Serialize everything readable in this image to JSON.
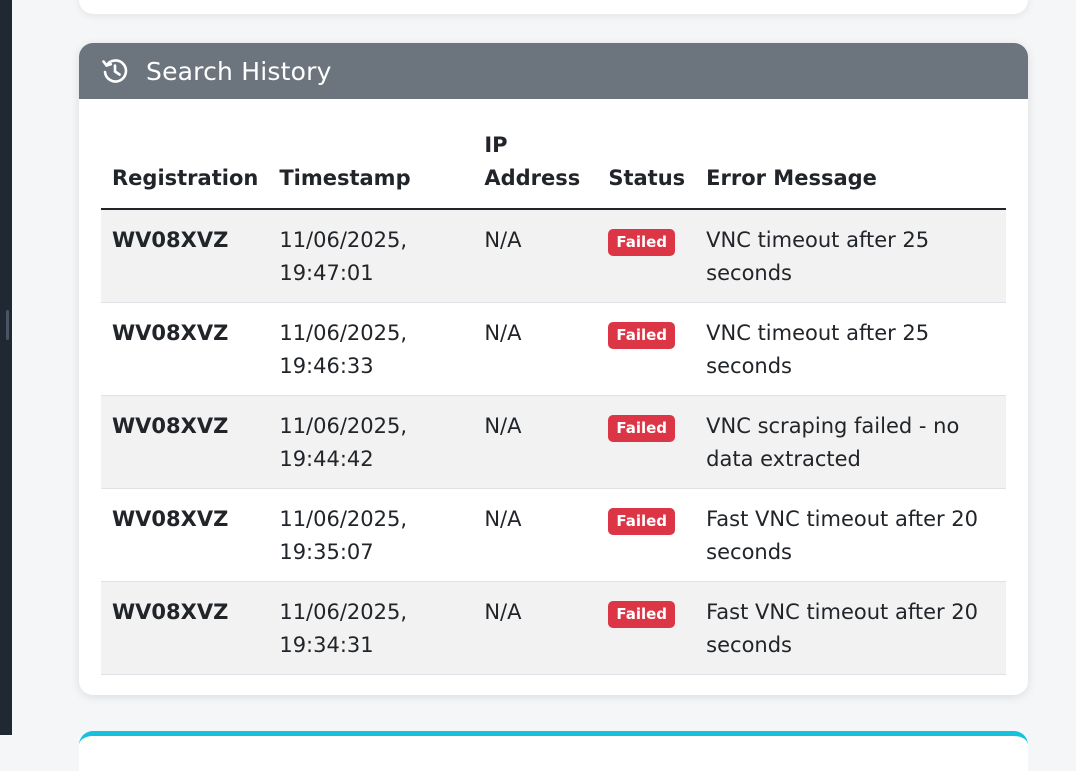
{
  "card": {
    "title": "Search History",
    "icon": "history-icon"
  },
  "table": {
    "headers": {
      "registration": "Registration",
      "timestamp": "Timestamp",
      "ip_line1": "IP",
      "ip_line2": "Address",
      "status": "Status",
      "error": "Error Message"
    },
    "rows": [
      {
        "registration": "WV08XVZ",
        "timestamp": "11/06/2025, 19:47:01",
        "ip": "N/A",
        "status": "Failed",
        "error": "VNC timeout after 25 seconds"
      },
      {
        "registration": "WV08XVZ",
        "timestamp": "11/06/2025, 19:46:33",
        "ip": "N/A",
        "status": "Failed",
        "error": "VNC timeout after 25 seconds"
      },
      {
        "registration": "WV08XVZ",
        "timestamp": "11/06/2025, 19:44:42",
        "ip": "N/A",
        "status": "Failed",
        "error": "VNC scraping failed - no data extracted"
      },
      {
        "registration": "WV08XVZ",
        "timestamp": "11/06/2025, 19:35:07",
        "ip": "N/A",
        "status": "Failed",
        "error": "Fast VNC timeout after 20 seconds"
      },
      {
        "registration": "WV08XVZ",
        "timestamp": "11/06/2025, 19:34:31",
        "ip": "N/A",
        "status": "Failed",
        "error": "Fast VNC timeout after 20 seconds"
      }
    ]
  },
  "colors": {
    "header_bg": "#6c757d",
    "failed_badge": "#dc3545",
    "next_card_accent": "#17c1dc"
  }
}
